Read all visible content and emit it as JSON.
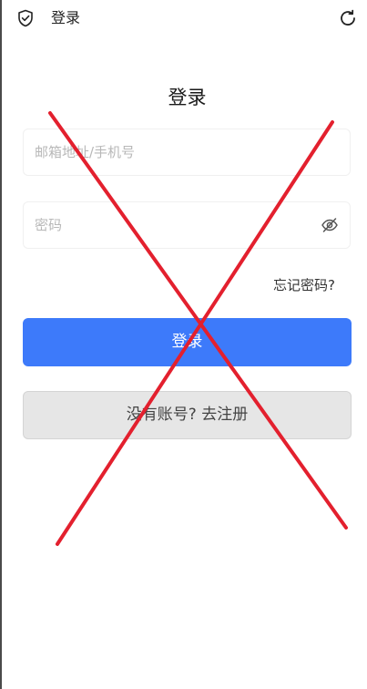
{
  "topbar": {
    "title": "登录",
    "left_icon": "shield-check-icon",
    "right_icon": "refresh-icon"
  },
  "form": {
    "heading": "登录",
    "account_placeholder": "邮箱地址/手机号",
    "account_value": "",
    "password_placeholder": "密码",
    "password_value": "",
    "password_toggle_icon": "eye-off-icon",
    "forgot_label": "忘记密码?",
    "login_label": "登录",
    "register_label": "没有账号? 去注册"
  },
  "overlay": {
    "mark": "cross-out-icon",
    "color": "#e3202e"
  },
  "colors": {
    "primary": "#3d7afa",
    "secondary_button": "#e6e6e6"
  }
}
